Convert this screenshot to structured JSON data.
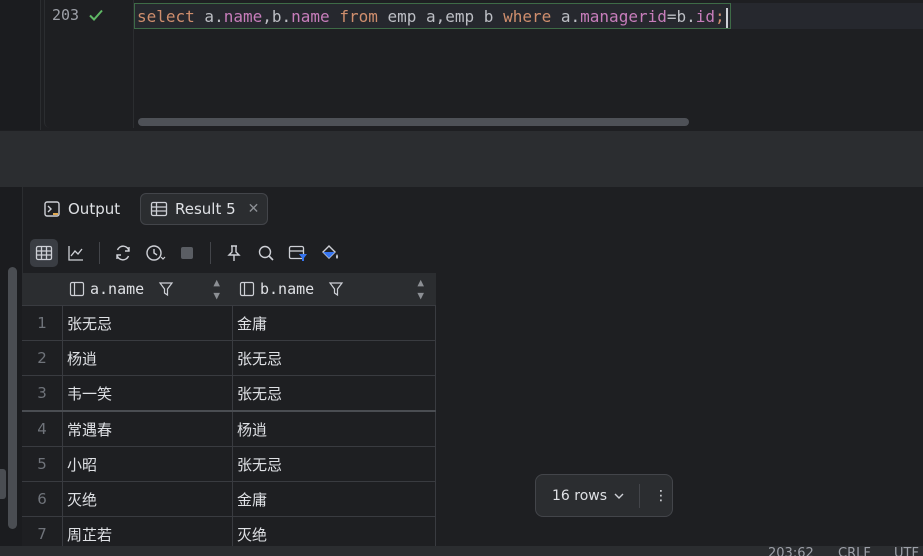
{
  "editor": {
    "line_number": "203",
    "code": {
      "t1": "select",
      "t2": " a.",
      "t3": "name",
      "t4": ",b.",
      "t5": "name",
      "t6": " ",
      "t7": "from",
      "t8": " emp a,emp b ",
      "t9": "where",
      "t10": " a.",
      "t11": "managerid",
      "t12": "=b.",
      "t13": "id",
      "t14": ";"
    }
  },
  "tabs": {
    "output_label": "Output",
    "result_label": "Result 5",
    "close_glyph": "✕"
  },
  "table": {
    "columns": [
      "a.name",
      "b.name"
    ],
    "rows": [
      {
        "n": "1",
        "a": "张无忌",
        "b": "金庸"
      },
      {
        "n": "2",
        "a": "杨逍",
        "b": "张无忌"
      },
      {
        "n": "3",
        "a": "韦一笑",
        "b": "张无忌"
      },
      {
        "n": "4",
        "a": "常遇春",
        "b": "杨逍"
      },
      {
        "n": "5",
        "a": "小昭",
        "b": "张无忌"
      },
      {
        "n": "6",
        "a": "灭绝",
        "b": "金庸"
      },
      {
        "n": "7",
        "a": "周芷若",
        "b": "灭绝"
      }
    ]
  },
  "rows_pill": {
    "label": "16 rows",
    "more_glyph": "⋮"
  },
  "status": {
    "position": "203:62",
    "line_sep": "CRLF",
    "encoding": "UTF"
  }
}
